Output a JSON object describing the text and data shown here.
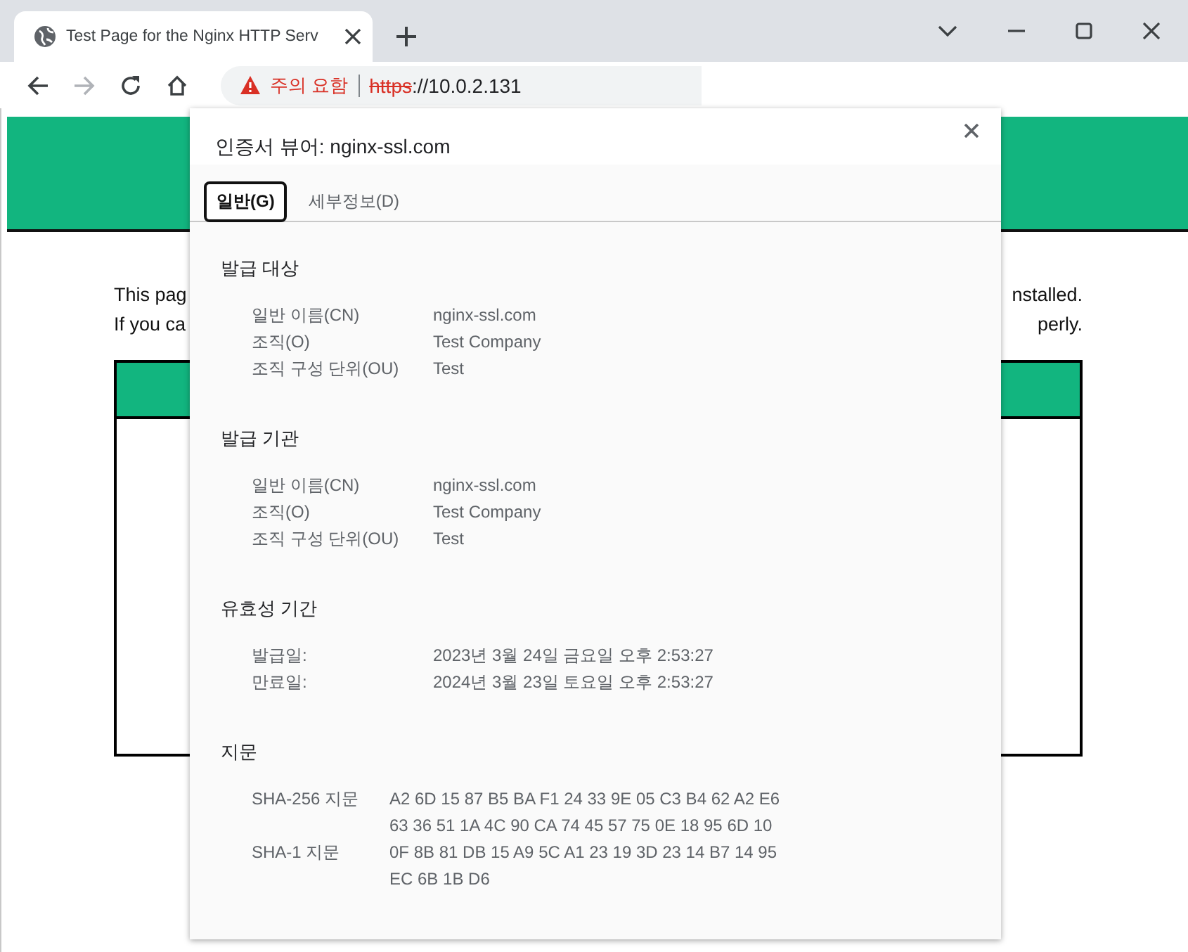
{
  "browser": {
    "tabs": [
      {
        "title": "Test Page for the Nginx HTTP Serv",
        "selected": true
      }
    ],
    "address": {
      "security_label": "주의 요함",
      "scheme": "https",
      "rest": "://10.0.2.131"
    },
    "forward_disabled": true
  },
  "page": {
    "lines": [
      {
        "start": "This pag",
        "end": "nstalled."
      },
      {
        "start": "If you ca",
        "end": "perly."
      }
    ]
  },
  "dialog": {
    "title": "인증서 뷰어: nginx-ssl.com",
    "tabs": [
      {
        "label": "일반(G)",
        "selected": true
      },
      {
        "label": "세부정보(D)",
        "selected": false
      }
    ],
    "sections": [
      {
        "heading": "발급 대상",
        "kind": "fields",
        "rows": [
          {
            "label": "일반 이름(CN)",
            "values": [
              "nginx-ssl.com"
            ]
          },
          {
            "label": "조직(O)",
            "values": [
              "Test Company"
            ]
          },
          {
            "label": "조직 구성 단위(OU)",
            "values": [
              "Test"
            ]
          }
        ]
      },
      {
        "heading": "발급 기관",
        "kind": "fields",
        "rows": [
          {
            "label": "일반 이름(CN)",
            "values": [
              "nginx-ssl.com"
            ]
          },
          {
            "label": "조직(O)",
            "values": [
              "Test Company"
            ]
          },
          {
            "label": "조직 구성 단위(OU)",
            "values": [
              "Test"
            ]
          }
        ]
      },
      {
        "heading": "유효성 기간",
        "kind": "fields",
        "rows": [
          {
            "label": "발급일:",
            "values": [
              "2023년 3월 24일 금요일 오후 2:53:27"
            ]
          },
          {
            "label": "만료일:",
            "values": [
              "2024년 3월 23일 토요일 오후 2:53:27"
            ]
          }
        ]
      },
      {
        "heading": "지문",
        "kind": "hashes",
        "rows": [
          {
            "label": "SHA-256 지문",
            "values": [
              "A2 6D 15 87 B5 BA F1 24 33 9E 05 C3 B4 62 A2 E6",
              "63 36 51 1A 4C 90 CA 74 45 57 75 0E 18 95 6D 10"
            ]
          },
          {
            "label": "SHA-1 지문",
            "values": [
              "0F 8B 81 DB 15 A9 5C A1 23 19 3D 23 14 B7 14 95",
              "EC 6B 1B D6"
            ]
          }
        ]
      }
    ]
  }
}
